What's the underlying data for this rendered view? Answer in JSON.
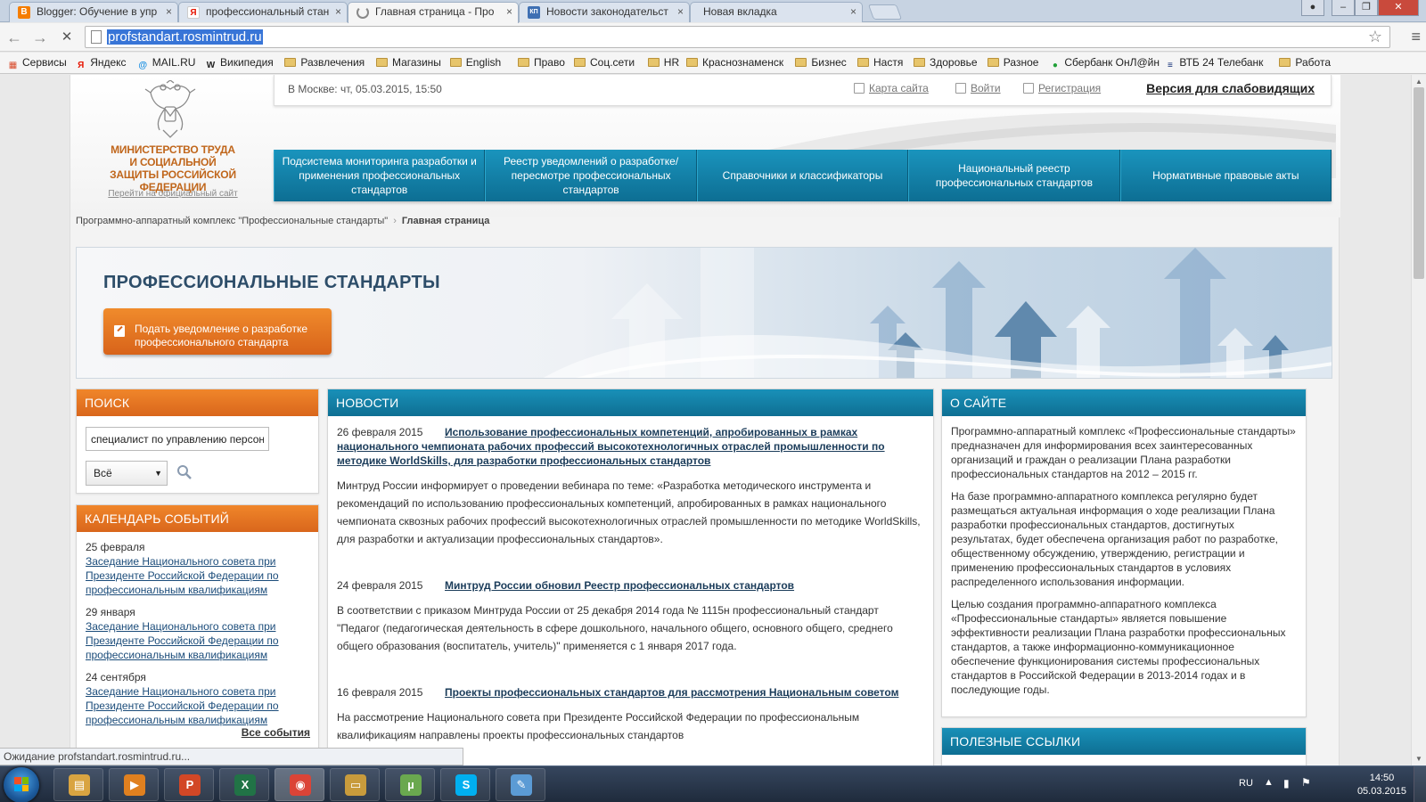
{
  "browser": {
    "tabs": [
      {
        "title": "Blogger: Обучение в упр",
        "favicon": "blogger-icon",
        "color": "#f57d00"
      },
      {
        "title": "профессиональный стан",
        "favicon": "yandex-icon",
        "color": "#e61400"
      },
      {
        "title": "Главная страница - Про",
        "favicon": "loading-icon",
        "color": "#888888"
      },
      {
        "title": "Новости законодательст",
        "favicon": "consultant-icon",
        "color": "#3e6fb3"
      },
      {
        "title": "Новая вкладка",
        "favicon": "",
        "color": ""
      }
    ],
    "tab_close": "×",
    "window_buttons": {
      "user": "●",
      "minimize": "–",
      "maximize": "❐",
      "close": "✕"
    },
    "nav": {
      "back": "←",
      "forward": "→",
      "stop": "✕"
    },
    "url": "profstandart.rosmintrud.ru",
    "bookmarks": [
      {
        "label": "Сервисы",
        "icon": "apps-icon"
      },
      {
        "label": "Яндекс",
        "icon": "yandex-icon"
      },
      {
        "label": "MAIL.RU",
        "icon": "mailru-icon"
      },
      {
        "label": "Википедия",
        "icon": "wikipedia-icon"
      },
      {
        "label": "Развлечения",
        "icon": "folder-icon"
      },
      {
        "label": "Магазины",
        "icon": "folder-icon"
      },
      {
        "label": "English",
        "icon": "folder-icon"
      },
      {
        "label": "Право",
        "icon": "folder-icon"
      },
      {
        "label": "Соц.сети",
        "icon": "folder-icon"
      },
      {
        "label": "HR",
        "icon": "folder-icon"
      },
      {
        "label": "Краснознаменск",
        "icon": "folder-icon"
      },
      {
        "label": "Бизнес",
        "icon": "folder-icon"
      },
      {
        "label": "Настя",
        "icon": "folder-icon"
      },
      {
        "label": "Здоровье",
        "icon": "folder-icon"
      },
      {
        "label": "Разное",
        "icon": "folder-icon"
      },
      {
        "label": "Сбербанк ОнЛ@йн",
        "icon": "sberbank-icon"
      },
      {
        "label": "ВТБ 24 Телебанк",
        "icon": "vtb-icon"
      },
      {
        "label": "Работа",
        "icon": "folder-icon"
      }
    ],
    "status": "Ожидание profstandart.rosmintrud.ru..."
  },
  "site": {
    "ministry_name": "МИНИСТЕРСТВО ТРУДА И СОЦИАЛЬНОЙ ЗАЩИТЫ РОССИЙСКОЙ ФЕДЕРАЦИИ",
    "official_link": "Перейти на официальный сайт",
    "datetime": "В Москве: чт, 05.03.2015, 15:50",
    "top_links": {
      "sitemap": "Карта сайта",
      "login": "Войти",
      "register": "Регистрация"
    },
    "low_vision": "Версия для слабовидящих",
    "nav": [
      "Подсистема мониторинга разработки и применения профессиональных стандартов",
      "Реестр уведомлений о разработке/ пересмотре профессиональных стандартов",
      "Справочники и классификаторы",
      "Национальный реестр профессиональных стандартов",
      "Нормативные правовые акты"
    ],
    "breadcrumb": {
      "root": "Программно-аппаратный комплекс \"Профессиональные стандарты\"",
      "sep": "›",
      "current": "Главная страница"
    },
    "banner": {
      "title": "ПРОФЕССИОНАЛЬНЫЕ СТАНДАРТЫ",
      "button": "Подать уведомление о разработке профессионального стандарта"
    },
    "search": {
      "title": "ПОИСК",
      "value": "специалист по управлению персон",
      "select": "Всё",
      "select_arrow": "▼"
    },
    "calendar": {
      "title": "КАЛЕНДАРЬ СОБЫТИЙ",
      "events": [
        {
          "date": "25 февраля",
          "text": "Заседание Национального совета при Президенте Российской Федерации по профессиональным квалификациям"
        },
        {
          "date": "29 января",
          "text": "Заседание Национального совета при Президенте Российской Федерации по профессиональным квалификациям"
        },
        {
          "date": "24 сентября",
          "text": "Заседание Национального совета при Президенте Российской Федерации по профессиональным квалификациям"
        }
      ],
      "all": "Все события"
    },
    "news": {
      "title": "НОВОСТИ",
      "items": [
        {
          "date": "26 февраля 2015",
          "title": "Использование профессиональных компетенций, апробированных в рамках национального чемпионата рабочих профессий высокотехнологичных отраслей промышленности по методике WorldSkills, для разработки профессиональных стандартов",
          "body": "Минтруд России информирует о проведении вебинара по теме: «Разработка методического инструмента и рекомендаций по использованию профессиональных компетенций, апробированных в рамках национального чемпионата сквозных рабочих профессий высокотехнологичных отраслей промышленности по методике WorldSkills, для разработки и актуализации профессиональных стандартов»."
        },
        {
          "date": "24 февраля 2015",
          "title": "Минтруд России обновил Реестр профессиональных стандартов",
          "body": "В соответствии с приказом Минтруда России от 25 декабря 2014 года № 1115н профессиональный стандарт \"Педагог (педагогическая деятельность в сфере дошкольного, начального общего, основного общего, среднего общего образования (воспитатель, учитель)\" применяется с 1 января 2017 года."
        },
        {
          "date": "16 февраля 2015",
          "title": "Проекты профессиональных стандартов для рассмотрения Национальным советом",
          "body": "На рассмотрение Национального совета при Президенте Российской Федерации по профессиональным квалификациям направлены проекты профессиональных стандартов"
        }
      ]
    },
    "about": {
      "title": "О САЙТЕ",
      "paragraphs": [
        "Программно-аппаратный комплекс «Профессиональные стандарты» предназначен для информирования всех заинтересованных организаций и граждан о реализации Плана разработки профессиональных стандартов на 2012 – 2015 гг.",
        "На базе программно-аппаратного комплекса регулярно будет размещаться актуальная информация о ходе реализации Плана разработки профессиональных стандартов, достигнутых результатах, будет обеспечена организация работ по разработке, общественному обсуждению, утверждению, регистрации и применению профессиональных стандартов в условиях распределенного использования информации.",
        "Целью создания программно-аппаратного комплекса «Профессиональные стандарты» является повышение эффективности реализации Плана разработки профессиональных стандартов, а также информационно-коммуникационное обеспечение функционирования системы профессиональных стандартов в Российской Федерации в 2013-2014 годах и в последующие годы."
      ]
    },
    "links": {
      "title": "ПОЛЕЗНЫЕ ССЫЛКИ"
    }
  },
  "taskbar": {
    "apps": [
      {
        "name": "explorer-icon",
        "color": "#d9a441",
        "glyph": "▤"
      },
      {
        "name": "media-player-icon",
        "color": "#e0801f",
        "glyph": "▶"
      },
      {
        "name": "powerpoint-icon",
        "color": "#d24726",
        "glyph": "P"
      },
      {
        "name": "excel-icon",
        "color": "#217346",
        "glyph": "X"
      },
      {
        "name": "chrome-icon",
        "color": "#db4437",
        "glyph": "◉"
      },
      {
        "name": "folder-icon",
        "color": "#c89b3c",
        "glyph": "▭"
      },
      {
        "name": "utorrent-icon",
        "color": "#6aa84f",
        "glyph": "µ"
      },
      {
        "name": "skype-icon",
        "color": "#00aff0",
        "glyph": "S"
      },
      {
        "name": "paint-icon",
        "color": "#5b9bd5",
        "glyph": "✎"
      }
    ],
    "lang": "RU",
    "time": "14:50",
    "date": "05.03.2015"
  }
}
